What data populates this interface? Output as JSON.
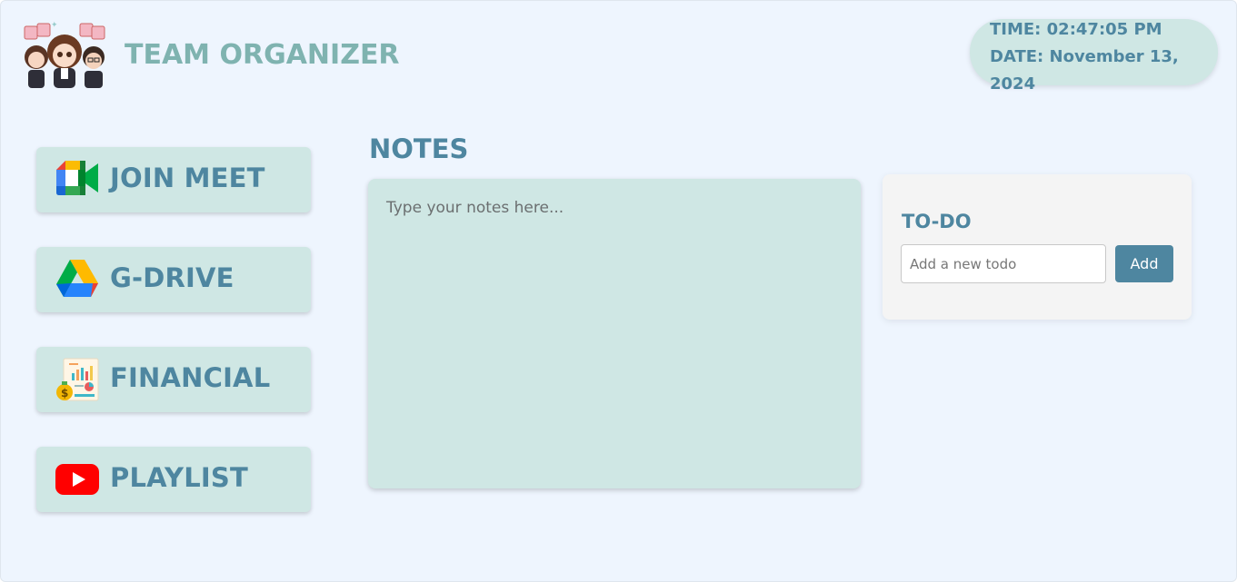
{
  "header": {
    "logo_caption": "Team Organizer",
    "title": "TEAM ORGANIZER"
  },
  "clock": {
    "time": "TIME: 02:47:05 PM",
    "date": "DATE: November 13, 2024"
  },
  "nav": {
    "items": [
      {
        "label": "JOIN MEET",
        "icon": "google-meet-icon"
      },
      {
        "label": "G-DRIVE",
        "icon": "google-drive-icon"
      },
      {
        "label": "FINANCIAL",
        "icon": "financial-report-icon"
      },
      {
        "label": "PLAYLIST",
        "icon": "youtube-icon"
      }
    ]
  },
  "notes": {
    "title": "NOTES",
    "placeholder": "Type your notes here..."
  },
  "todo": {
    "title": "TO-DO",
    "placeholder": "Add a new todo",
    "add_label": "Add"
  },
  "colors": {
    "background": "#eef5fe",
    "card": "#cfe7e4",
    "accent": "#4e86a0",
    "title": "#7fb3b0"
  }
}
